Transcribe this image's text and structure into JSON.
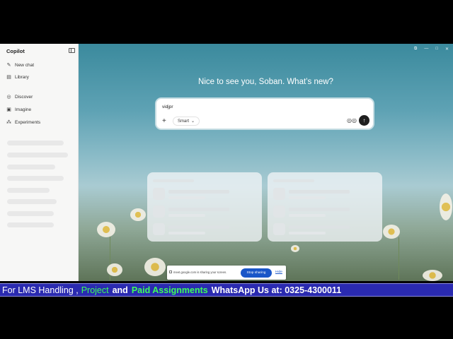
{
  "sidebar": {
    "brand": "Copilot",
    "items": [
      {
        "label": "New chat",
        "icon": "edit-icon"
      },
      {
        "label": "Library",
        "icon": "library-icon"
      },
      {
        "label": "Discover",
        "icon": "compass-icon"
      },
      {
        "label": "Imagine",
        "icon": "image-icon"
      },
      {
        "label": "Experiments",
        "icon": "grid-icon"
      }
    ]
  },
  "main": {
    "greeting": "Nice to see you, Soban. What’s new?",
    "composer": {
      "value": "vidjpr",
      "mode": "Smart"
    }
  },
  "share_bar": {
    "message": "meet.google.com is sharing your screen.",
    "stop_label": "Stop sharing",
    "hide_label": "Hide"
  },
  "banner": {
    "part1": "For LMS Handling ,",
    "part2": "Project",
    "part3": "and",
    "part4": "Paid Assignments",
    "part5": "WhatsApp Us at: 0325-4300011"
  },
  "colors": {
    "accent": "#1a56c8",
    "banner_bg": "#2a2ab0",
    "banner_green": "#3dff5a",
    "banner_white": "#ffffff"
  }
}
